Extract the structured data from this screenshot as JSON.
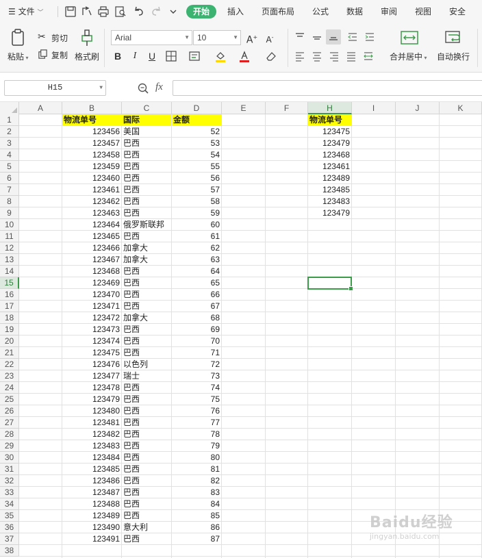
{
  "menubar": {
    "file_label": "文件",
    "tabs": [
      "开始",
      "插入",
      "页面布局",
      "公式",
      "数据",
      "审阅",
      "视图",
      "安全"
    ],
    "active_tab": "开始"
  },
  "ribbon": {
    "paste_label": "粘贴",
    "cut_label": "剪切",
    "copy_label": "复制",
    "format_painter_label": "格式刷",
    "font_name": "Arial",
    "font_size": "10",
    "merge_center_label": "合并居中",
    "wrap_text_label": "自动换行",
    "font_color": "#e02020",
    "fill_color": "#ffd700"
  },
  "formula_bar": {
    "name_box": "H15",
    "fx_label": "fx",
    "formula": ""
  },
  "grid": {
    "columns": [
      "A",
      "B",
      "C",
      "D",
      "E",
      "F",
      "H",
      "I",
      "J",
      "K"
    ],
    "selected_column": "H",
    "selected_row": 15,
    "header_fill": "#ffff00",
    "headers": {
      "b1": "物流单号",
      "c1": "国际",
      "d1": "金额",
      "h1": "物流单号"
    },
    "rows": [
      {
        "b": "123456",
        "c": "美国",
        "d": "52"
      },
      {
        "b": "123457",
        "c": "巴西",
        "d": "53"
      },
      {
        "b": "123458",
        "c": "巴西",
        "d": "54"
      },
      {
        "b": "123459",
        "c": "巴西",
        "d": "55"
      },
      {
        "b": "123460",
        "c": "巴西",
        "d": "56"
      },
      {
        "b": "123461",
        "c": "巴西",
        "d": "57"
      },
      {
        "b": "123462",
        "c": "巴西",
        "d": "58"
      },
      {
        "b": "123463",
        "c": "巴西",
        "d": "59"
      },
      {
        "b": "123464",
        "c": "俄罗斯联邦",
        "d": "60"
      },
      {
        "b": "123465",
        "c": "巴西",
        "d": "61"
      },
      {
        "b": "123466",
        "c": "加拿大",
        "d": "62"
      },
      {
        "b": "123467",
        "c": "加拿大",
        "d": "63"
      },
      {
        "b": "123468",
        "c": "巴西",
        "d": "64"
      },
      {
        "b": "123469",
        "c": "巴西",
        "d": "65"
      },
      {
        "b": "123470",
        "c": "巴西",
        "d": "66"
      },
      {
        "b": "123471",
        "c": "巴西",
        "d": "67"
      },
      {
        "b": "123472",
        "c": "加拿大",
        "d": "68"
      },
      {
        "b": "123473",
        "c": "巴西",
        "d": "69"
      },
      {
        "b": "123474",
        "c": "巴西",
        "d": "70"
      },
      {
        "b": "123475",
        "c": "巴西",
        "d": "71"
      },
      {
        "b": "123476",
        "c": "以色列",
        "d": "72"
      },
      {
        "b": "123477",
        "c": "瑞士",
        "d": "73"
      },
      {
        "b": "123478",
        "c": "巴西",
        "d": "74"
      },
      {
        "b": "123479",
        "c": "巴西",
        "d": "75"
      },
      {
        "b": "123480",
        "c": "巴西",
        "d": "76"
      },
      {
        "b": "123481",
        "c": "巴西",
        "d": "77"
      },
      {
        "b": "123482",
        "c": "巴西",
        "d": "78"
      },
      {
        "b": "123483",
        "c": "巴西",
        "d": "79"
      },
      {
        "b": "123484",
        "c": "巴西",
        "d": "80"
      },
      {
        "b": "123485",
        "c": "巴西",
        "d": "81"
      },
      {
        "b": "123486",
        "c": "巴西",
        "d": "82"
      },
      {
        "b": "123487",
        "c": "巴西",
        "d": "83"
      },
      {
        "b": "123488",
        "c": "巴西",
        "d": "84"
      },
      {
        "b": "123489",
        "c": "巴西",
        "d": "85"
      },
      {
        "b": "123490",
        "c": "意大利",
        "d": "86"
      },
      {
        "b": "123491",
        "c": "巴西",
        "d": "87"
      }
    ],
    "h_values": [
      "123475",
      "123479",
      "123468",
      "123461",
      "123489",
      "123485",
      "123483",
      "123479"
    ],
    "row_count": 38
  },
  "watermark": {
    "logo_text": "Baidu经验",
    "url_text": "jingyan.baidu.com"
  }
}
